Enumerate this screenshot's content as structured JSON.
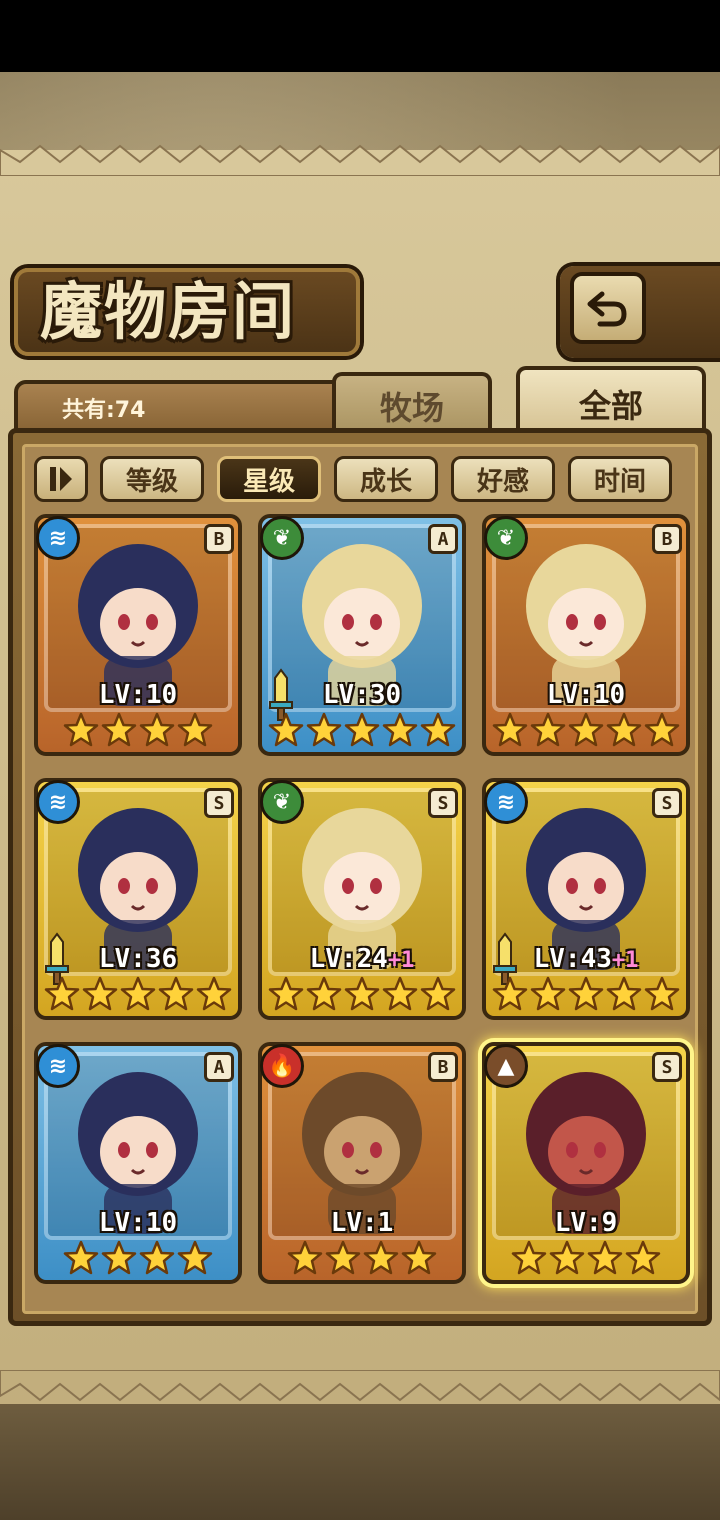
{
  "header": {
    "title": "魔物房间",
    "back_icon": "back-arrow-icon"
  },
  "summary": {
    "count_label": "共有:74"
  },
  "tabs": [
    {
      "label": "牧场",
      "active": false
    },
    {
      "label": "全部",
      "active": true
    }
  ],
  "sort": {
    "toggle_icon": "sort-direction-icon",
    "options": [
      {
        "label": "等级",
        "active": false
      },
      {
        "label": "星级",
        "active": true
      },
      {
        "label": "成长",
        "active": false
      },
      {
        "label": "好感",
        "active": false
      },
      {
        "label": "时间",
        "active": false
      }
    ]
  },
  "monsters": [
    {
      "element": "water",
      "rank": "B",
      "level": "LV:10",
      "plus": "",
      "stars": 4,
      "weapon": false,
      "selected": false
    },
    {
      "element": "nature",
      "rank": "A",
      "level": "LV:30",
      "plus": "",
      "stars": 5,
      "weapon": true,
      "selected": false
    },
    {
      "element": "nature",
      "rank": "B",
      "level": "LV:10",
      "plus": "",
      "stars": 5,
      "weapon": false,
      "selected": false
    },
    {
      "element": "water",
      "rank": "S",
      "level": "LV:36",
      "plus": "",
      "stars": 5,
      "weapon": true,
      "selected": false
    },
    {
      "element": "nature",
      "rank": "S",
      "level": "LV:24",
      "plus": "+1",
      "stars": 5,
      "weapon": false,
      "selected": false
    },
    {
      "element": "water",
      "rank": "S",
      "level": "LV:43",
      "plus": "+1",
      "stars": 5,
      "weapon": true,
      "selected": false
    },
    {
      "element": "water",
      "rank": "A",
      "level": "LV:10",
      "plus": "",
      "stars": 4,
      "weapon": false,
      "selected": false
    },
    {
      "element": "fire",
      "rank": "B",
      "level": "LV:1",
      "plus": "",
      "stars": 4,
      "weapon": false,
      "selected": false
    },
    {
      "element": "earth",
      "rank": "S",
      "level": "LV:9",
      "plus": "",
      "stars": 4,
      "weapon": false,
      "selected": true
    }
  ],
  "colors": {
    "panel": "#8a6a36",
    "rank_B": "#e0913c",
    "rank_A": "#7fc0e6",
    "rank_S": "#f5d34a",
    "star": "#ffd23a"
  }
}
